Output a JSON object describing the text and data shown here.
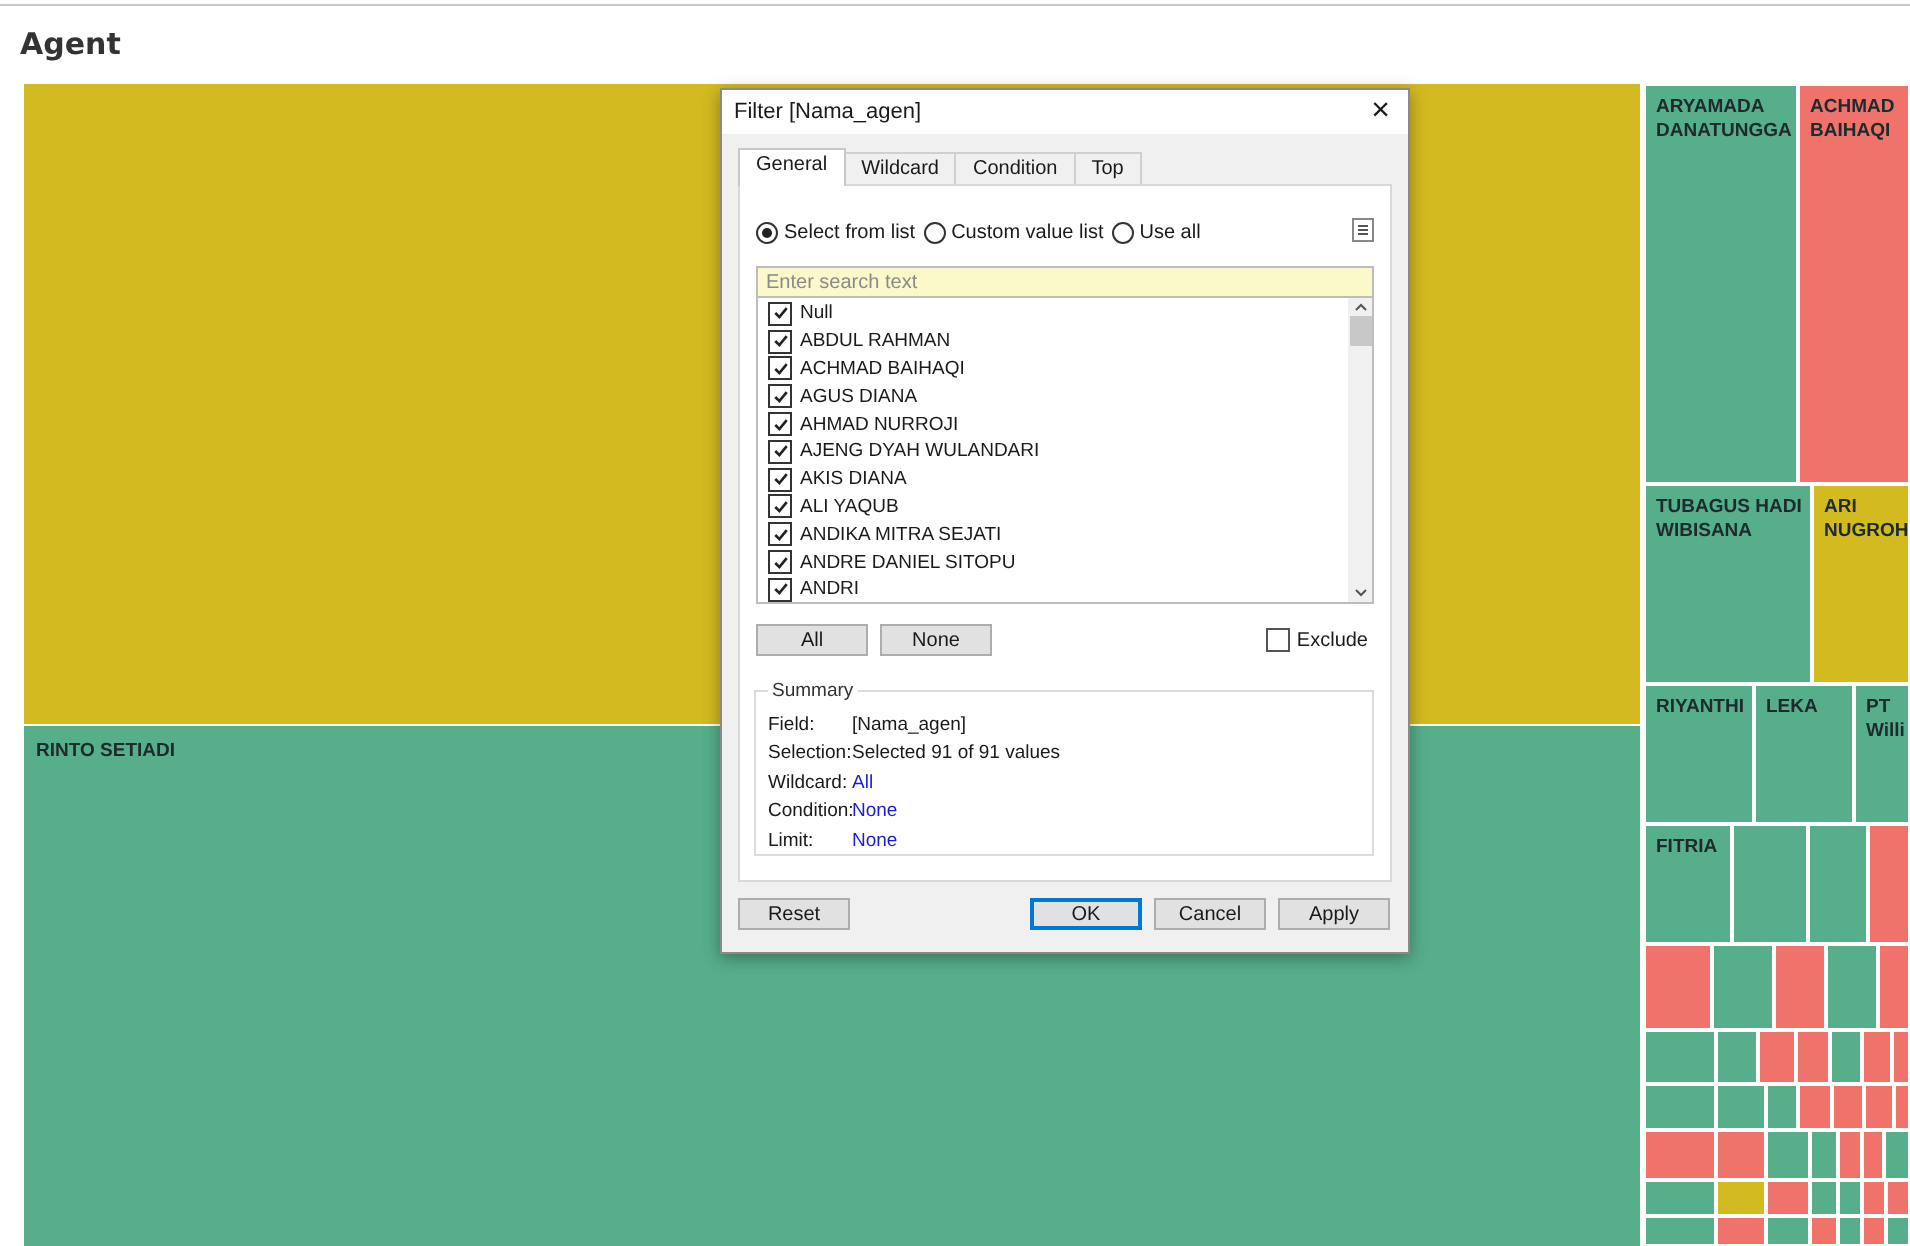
{
  "page": {
    "title": "Agent"
  },
  "treemap": {
    "left": [
      {
        "color": "#d4ba21"
      },
      {
        "label": "RINTO SETIADI",
        "color": "#57ae8a"
      }
    ],
    "bands": [
      {
        "tiles": [
          {
            "label": "ARYAMADA DANATUNGGA",
            "color": "#57ae8a"
          },
          {
            "label": "ACHMAD BAIHAQI",
            "color": "#ef726b"
          }
        ]
      },
      {
        "tiles": [
          {
            "label": "TUBAGUS HADI WIBISANA",
            "color": "#57ae8a"
          },
          {
            "label": "ARI NUGROH",
            "color": "#d4ba21"
          }
        ]
      },
      {
        "tiles": [
          {
            "label": "RIYANTHI",
            "color": "#57ae8a"
          },
          {
            "label": "LEKA",
            "color": "#57ae8a"
          },
          {
            "label": "PT Willi",
            "color": "#57ae8a"
          }
        ]
      },
      {
        "tiles": [
          {
            "label": "FITRIA",
            "color": "#57ae8a"
          },
          {
            "color": "#57ae8a"
          },
          {
            "color": "#57ae8a"
          },
          {
            "color": "#ef726b"
          }
        ]
      },
      {
        "tiles": [
          {
            "color": "#ef726b"
          },
          {
            "color": "#57ae8a"
          },
          {
            "color": "#ef726b"
          },
          {
            "color": "#57ae8a"
          },
          {
            "color": "#ef726b"
          }
        ]
      },
      {
        "tiles": [
          {
            "color": "#57ae8a"
          },
          {
            "color": "#57ae8a"
          },
          {
            "color": "#ef726b"
          },
          {
            "color": "#ef726b"
          },
          {
            "color": "#57ae8a"
          },
          {
            "color": "#ef726b"
          },
          {
            "color": "#ef726b"
          }
        ]
      },
      {
        "tiles": [
          {
            "color": "#57ae8a"
          },
          {
            "color": "#57ae8a"
          },
          {
            "color": "#57ae8a"
          },
          {
            "color": "#ef726b"
          },
          {
            "color": "#ef726b"
          },
          {
            "color": "#ef726b"
          },
          {
            "color": "#ef726b"
          }
        ]
      },
      {
        "tiles": [
          {
            "color": "#ef726b"
          },
          {
            "color": "#ef726b"
          },
          {
            "color": "#57ae8a"
          },
          {
            "color": "#57ae8a"
          },
          {
            "color": "#ef726b"
          },
          {
            "color": "#ef726b"
          },
          {
            "color": "#57ae8a"
          }
        ]
      },
      {
        "tiles": [
          {
            "color": "#57ae8a"
          },
          {
            "color": "#d4ba21"
          },
          {
            "color": "#ef726b"
          },
          {
            "color": "#57ae8a"
          },
          {
            "color": "#57ae8a"
          },
          {
            "color": "#ef726b"
          },
          {
            "color": "#ef726b"
          }
        ]
      },
      {
        "tiles": [
          {
            "color": "#57ae8a"
          },
          {
            "color": "#ef726b"
          },
          {
            "color": "#57ae8a"
          },
          {
            "color": "#ef726b"
          },
          {
            "color": "#57ae8a"
          },
          {
            "color": "#ef726b"
          },
          {
            "color": "#57ae8a"
          }
        ]
      }
    ]
  },
  "dialog": {
    "title": "Filter [Nama_agen]",
    "close": "×",
    "tabs": [
      {
        "label": "General",
        "selected": true
      },
      {
        "label": "Wildcard",
        "selected": false
      },
      {
        "label": "Condition",
        "selected": false
      },
      {
        "label": "Top",
        "selected": false
      }
    ],
    "modes": [
      {
        "label": "Select from list",
        "selected": true
      },
      {
        "label": "Custom value list",
        "selected": false
      },
      {
        "label": "Use all",
        "selected": false
      }
    ],
    "search": {
      "placeholder": "Enter search text"
    },
    "items": [
      {
        "label": "Null",
        "checked": true
      },
      {
        "label": "ABDUL RAHMAN",
        "checked": true
      },
      {
        "label": "ACHMAD BAIHAQI",
        "checked": true
      },
      {
        "label": "AGUS DIANA",
        "checked": true
      },
      {
        "label": "AHMAD NURROJI",
        "checked": true
      },
      {
        "label": "AJENG DYAH WULANDARI",
        "checked": true
      },
      {
        "label": "AKIS DIANA",
        "checked": true
      },
      {
        "label": "ALI YAQUB",
        "checked": true
      },
      {
        "label": "ANDIKA MITRA SEJATI",
        "checked": true
      },
      {
        "label": "ANDRE DANIEL SITOPU",
        "checked": true
      },
      {
        "label": "ANDRI",
        "checked": true
      }
    ],
    "list_buttons": [
      "All",
      "None"
    ],
    "exclude": {
      "label": "Exclude",
      "checked": false
    },
    "summary": {
      "title": "Summary",
      "rows": [
        {
          "label": "Field:",
          "value": "[Nama_agen]",
          "kind": "text"
        },
        {
          "label": "Selection:",
          "value": "Selected 91 of 91 values",
          "kind": "text"
        },
        {
          "label": "Wildcard:",
          "value": "All",
          "kind": "link"
        },
        {
          "label": "Condition:",
          "value": "None",
          "kind": "link"
        },
        {
          "label": "Limit:",
          "value": "None",
          "kind": "link"
        }
      ]
    },
    "buttons": [
      {
        "label": "Reset",
        "kind": "plain"
      },
      {
        "label": "OK",
        "kind": "default"
      },
      {
        "label": "Cancel",
        "kind": "plain"
      },
      {
        "label": "Apply",
        "kind": "plain"
      }
    ]
  }
}
